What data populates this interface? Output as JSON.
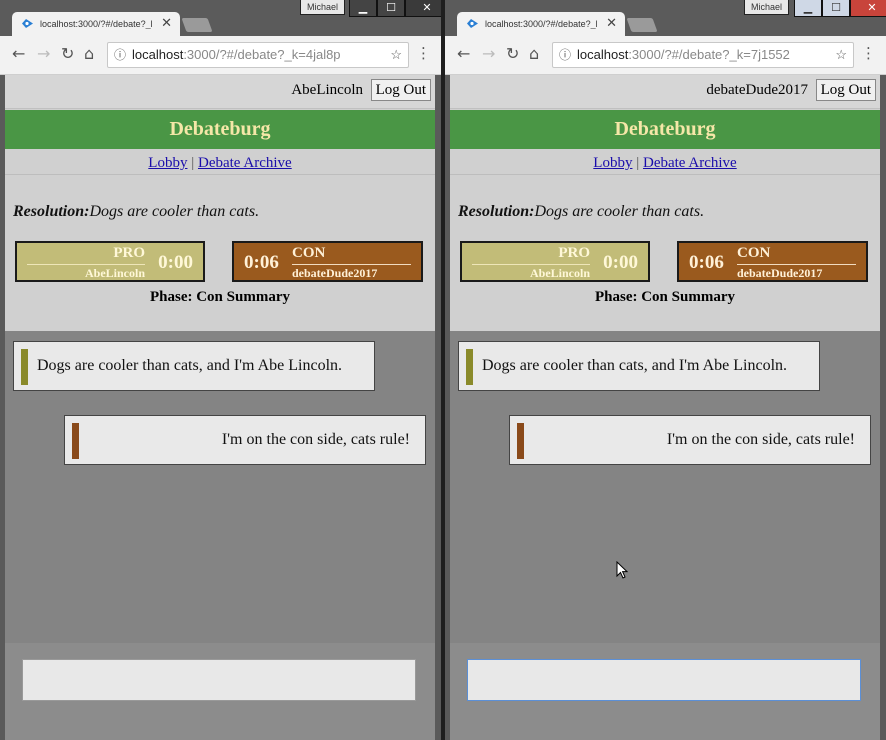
{
  "left": {
    "tab_title": "localhost:3000/?#/debate?_k=",
    "profile": "Michael",
    "url_host": "localhost",
    "url_rest": ":3000/?#/debate?_k=4jal8p",
    "username": "AbeLincoln"
  },
  "right": {
    "tab_title": "localhost:3000/?#/debate?_k=",
    "profile": "Michael",
    "url_host": "localhost",
    "url_rest": ":3000/?#/debate?_k=7j1552",
    "username": "debateDude2017"
  },
  "app": {
    "logout_label": "Log Out",
    "brand": "Debateburg",
    "nav": {
      "lobby": "Lobby",
      "separator": "|",
      "archive": "Debate Archive"
    },
    "resolution_label": "Resolution:",
    "resolution_text": "Dogs are cooler than cats.",
    "pro": {
      "label": "PRO",
      "name": "AbeLincoln",
      "time": "0:00",
      "color": "#c2bc78"
    },
    "con": {
      "label": "CON",
      "name": "debateDude2017",
      "time": "0:06",
      "color": "#9a5a1e"
    },
    "phase": "Phase: Con Summary",
    "messages": [
      {
        "side": "pro",
        "text": "Dogs are cooler than cats, and I'm Abe Lincoln."
      },
      {
        "side": "con",
        "text": "I'm on the con side, cats rule!"
      }
    ],
    "input_value": ""
  },
  "colors": {
    "brand_bar": "#4a9645",
    "brand_text": "#f5e7a8",
    "chat_bg": "#848484",
    "page_bg": "#d0d0d0"
  },
  "icons": [
    "favicon-icon",
    "tab-close-icon",
    "back-icon",
    "forward-icon",
    "reload-icon",
    "home-icon",
    "info-icon",
    "star-icon",
    "menu-icon",
    "minimize-icon",
    "maximize-icon",
    "window-close-icon",
    "mouse-cursor-icon"
  ]
}
